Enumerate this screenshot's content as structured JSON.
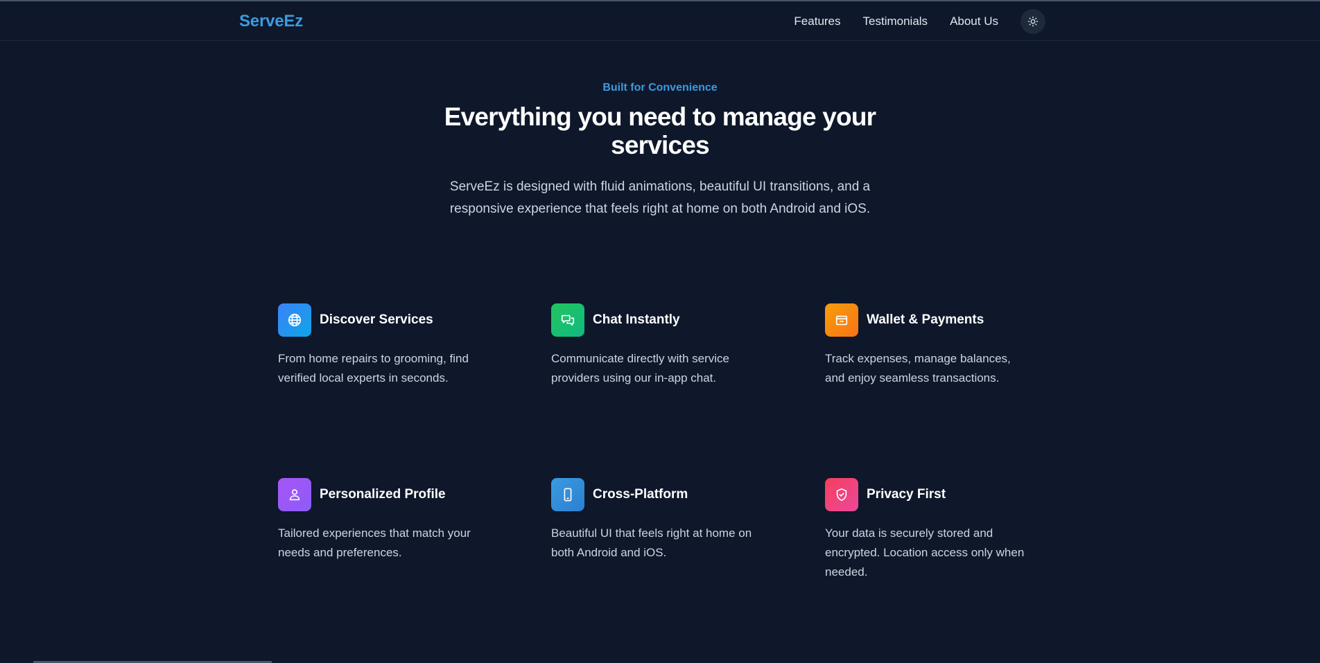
{
  "brand": {
    "name": "ServeEz"
  },
  "nav": {
    "items": [
      {
        "label": "Features"
      },
      {
        "label": "Testimonials"
      },
      {
        "label": "About Us"
      }
    ],
    "theme_toggle_icon": "sun-icon"
  },
  "hero": {
    "eyebrow": "Built for Convenience",
    "title": "Everything you need to manage your services",
    "description": "ServeEz is designed with fluid animations, beautiful UI transitions, and a responsive experience that feels right at home on both Android and iOS."
  },
  "features": [
    {
      "title": "Discover Services",
      "description": "From home repairs to grooming, find verified local experts in seconds.",
      "icon": "globe-icon",
      "color_from": "#3b82f6",
      "color_to": "#0ea5e9"
    },
    {
      "title": "Chat Instantly",
      "description": "Communicate directly with service providers using our in-app chat.",
      "icon": "chat-icon",
      "color_from": "#22c55e",
      "color_to": "#10b981"
    },
    {
      "title": "Wallet & Payments",
      "description": "Track expenses, manage balances, and enjoy seamless transactions.",
      "icon": "wallet-icon",
      "color_from": "#f59e0b",
      "color_to": "#f97316"
    },
    {
      "title": "Personalized Profile",
      "description": "Tailored experiences that match your needs and preferences.",
      "icon": "user-icon",
      "color_from": "#a855f7",
      "color_to": "#8b5cf6"
    },
    {
      "title": "Cross-Platform",
      "description": "Beautiful UI that feels right at home on both Android and iOS.",
      "icon": "smartphone-icon",
      "color_from": "#3b9be0",
      "color_to": "#2b7fd0"
    },
    {
      "title": "Privacy First",
      "description": "Your data is securely stored and encrypted. Location access only when needed.",
      "icon": "shield-check-icon",
      "color_from": "#f43f5e",
      "color_to": "#ec4899"
    }
  ]
}
